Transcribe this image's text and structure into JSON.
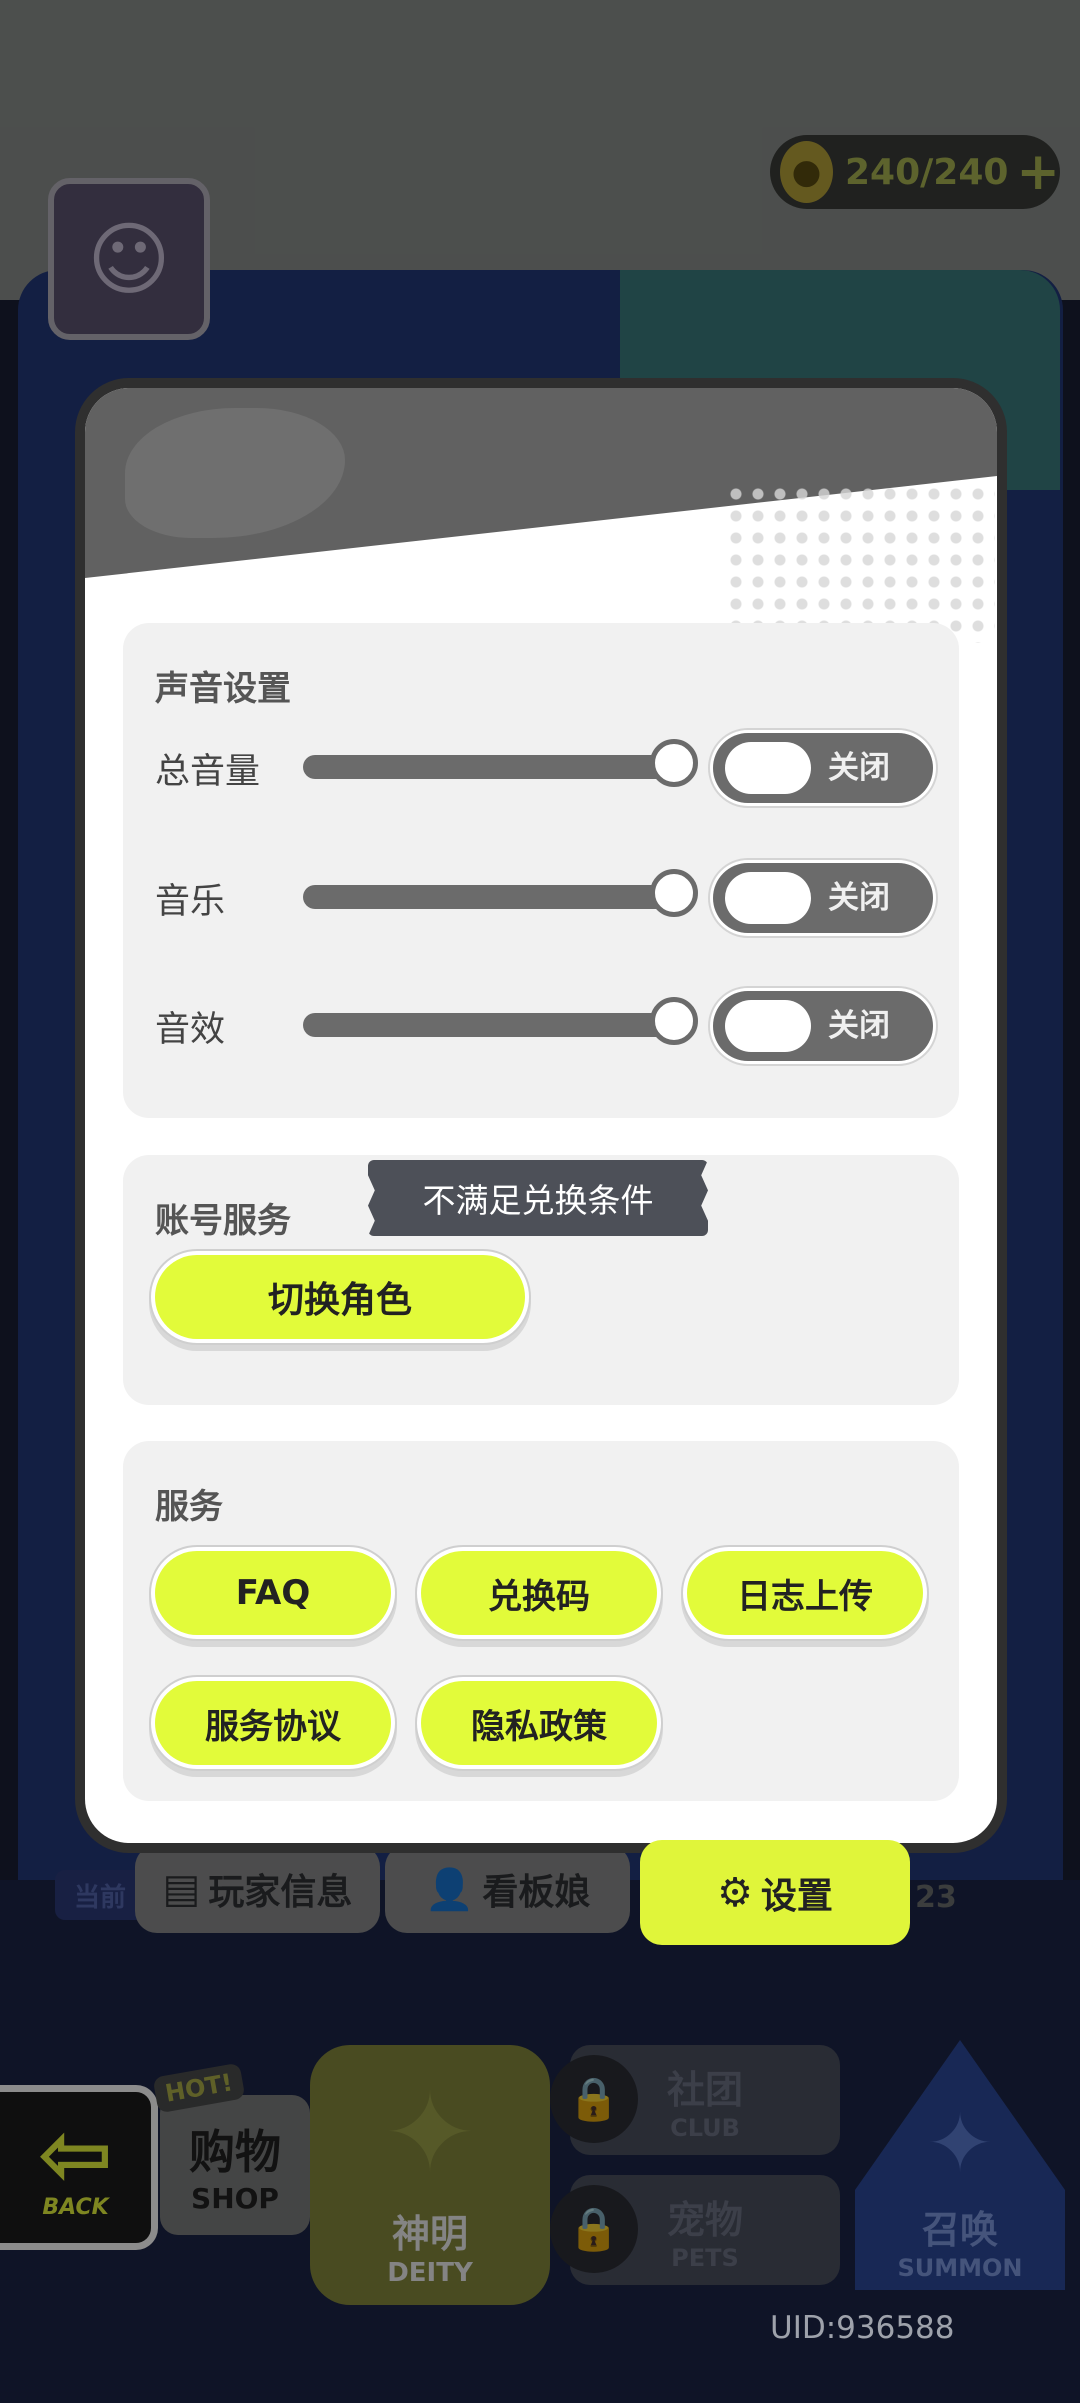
{
  "header": {
    "energy_text": "240/240",
    "energy_plus": "+"
  },
  "tabs": {
    "current_label": "当前",
    "player_info": "玩家信息",
    "board_girl": "看板娘",
    "settings": "设置",
    "number": "23"
  },
  "nav": {
    "back": "BACK",
    "hot": "HOT!",
    "shop_cn": "购物",
    "shop_en": "SHOP",
    "deity_cn": "神明",
    "deity_en": "DEITY",
    "club_cn": "社团",
    "club_en": "CLUB",
    "pets_cn": "宠物",
    "pets_en": "PETS",
    "summon_cn": "召唤",
    "summon_en": "SUMMON"
  },
  "uid": "UID:936588",
  "settings": {
    "sound": {
      "title": "声音设置",
      "rows": [
        {
          "label": "总音量",
          "level": 1.0,
          "toggle": "关闭"
        },
        {
          "label": "音乐",
          "level": 1.0,
          "toggle": "关闭"
        },
        {
          "label": "音效",
          "level": 1.0,
          "toggle": "关闭"
        }
      ]
    },
    "account": {
      "title": "账号服务",
      "switch_role": "切换角色",
      "tooltip": "不满足兑换条件"
    },
    "service": {
      "title": "服务",
      "faq": "FAQ",
      "redeem_code": "兑换码",
      "log_upload": "日志上传",
      "terms": "服务协议",
      "privacy": "隐私政策"
    }
  },
  "colors": {
    "accent": "#e2fb3a",
    "toggle_off": "#6b6b6b",
    "tooltip_bg": "#4d5058"
  }
}
